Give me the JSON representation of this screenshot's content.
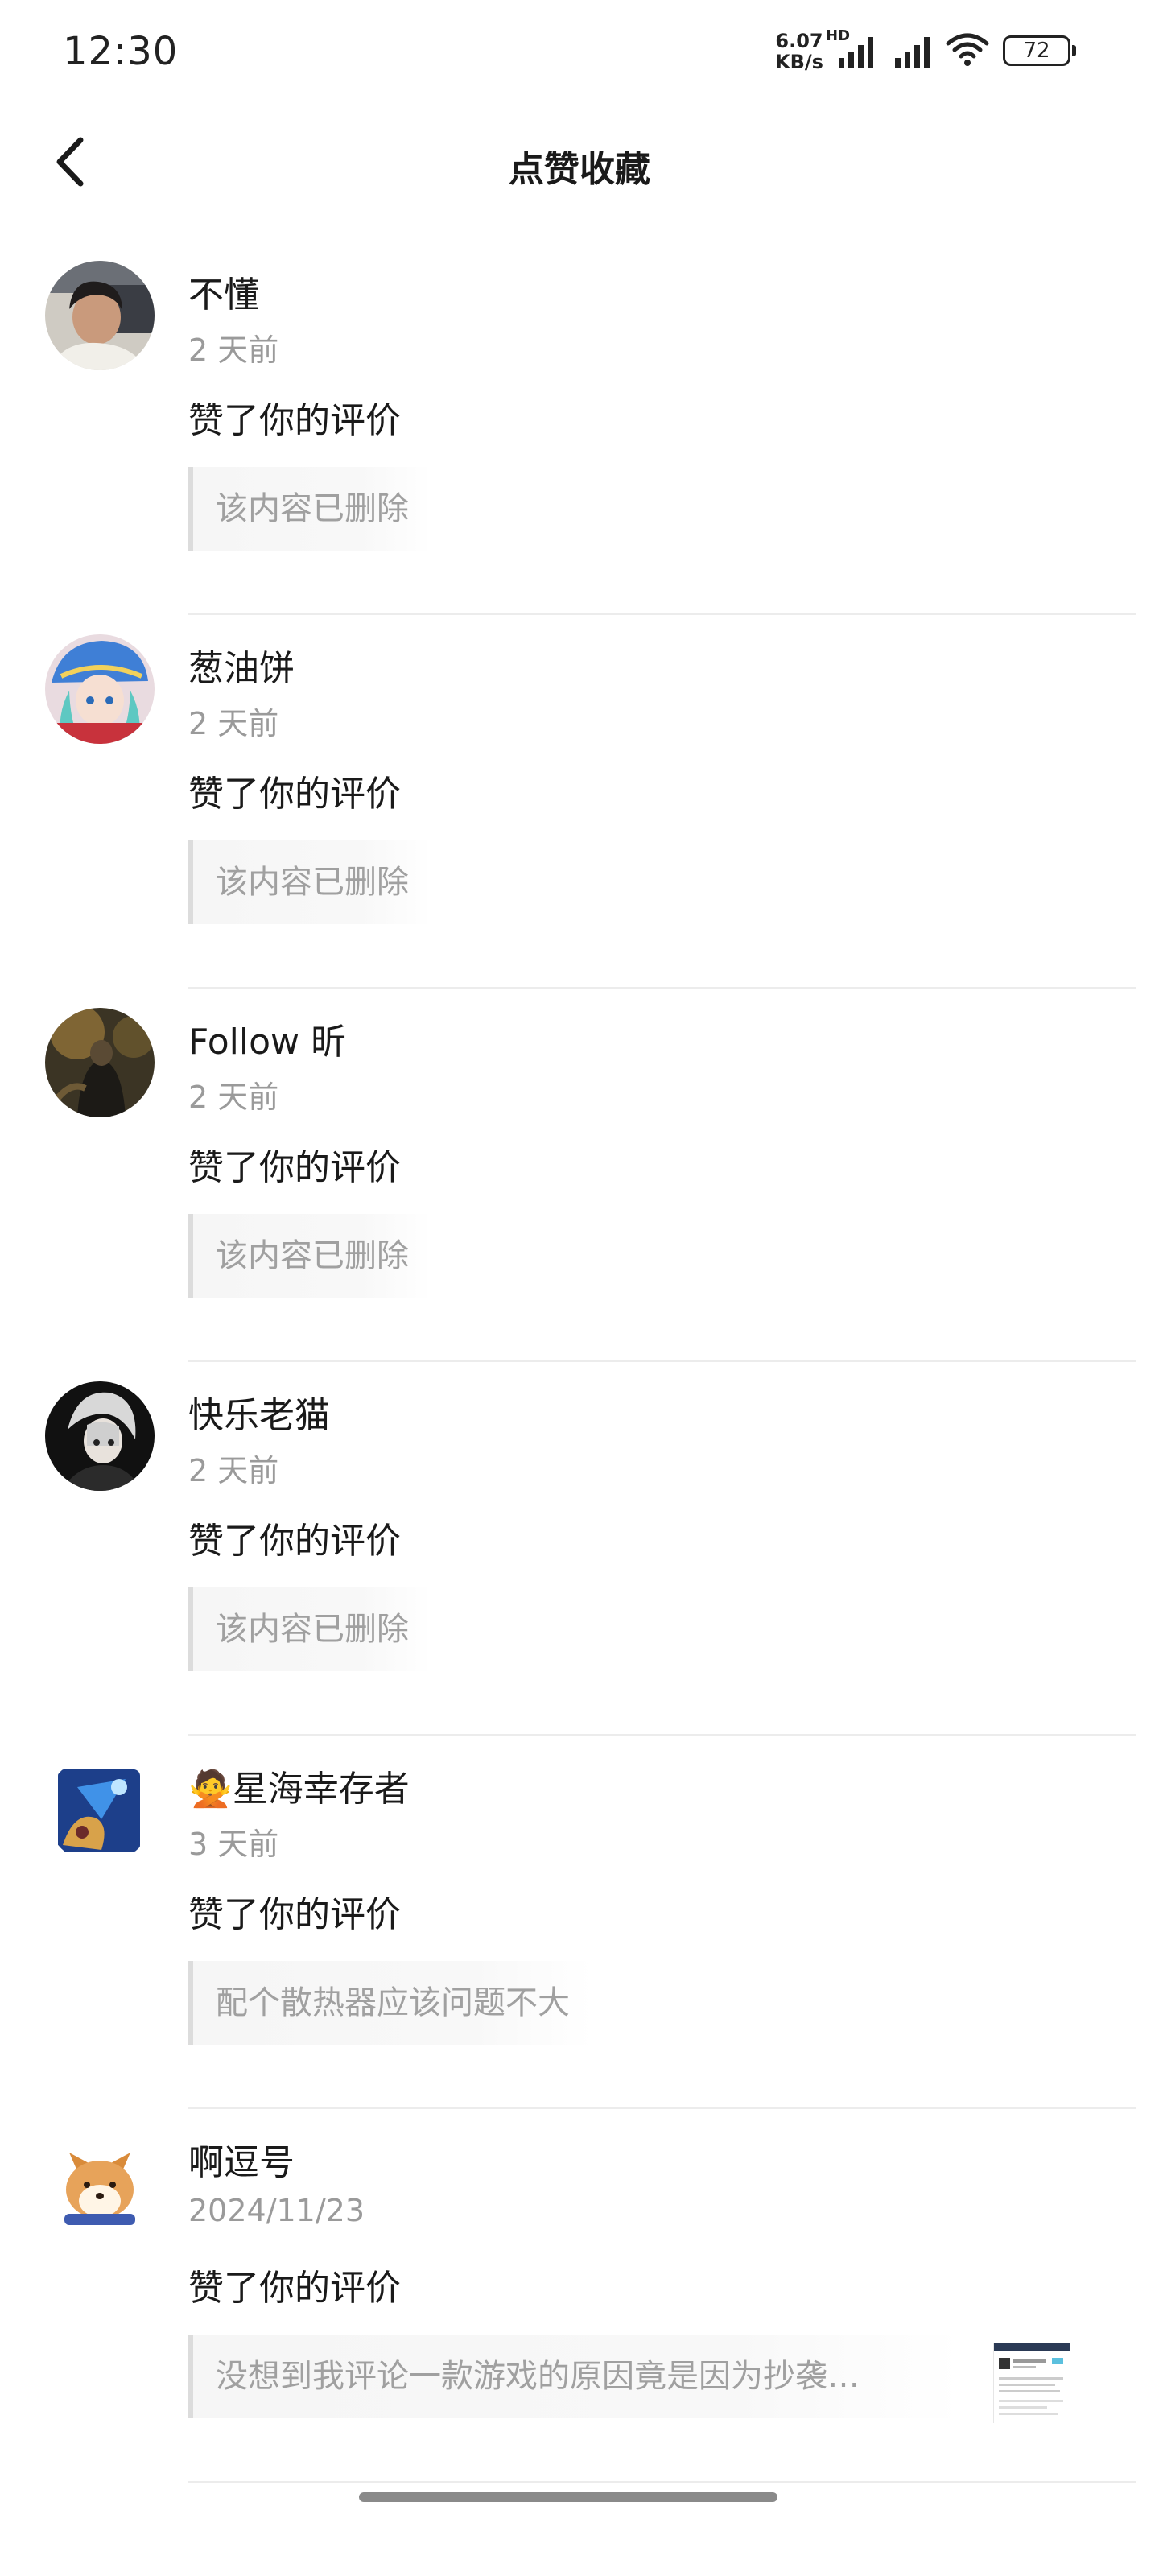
{
  "status_bar": {
    "time": "12:30",
    "net_speed_value": "6.07",
    "net_speed_unit": "KB/s",
    "hd_label": "HD",
    "battery": "72"
  },
  "header": {
    "title": "点赞收藏",
    "back_icon": "chevron-left-icon"
  },
  "items": [
    {
      "username": "不懂",
      "time": "2 天前",
      "action": "赞了你的评价",
      "quote": "该内容已删除"
    },
    {
      "username": "葱油饼",
      "time": "2 天前",
      "action": "赞了你的评价",
      "quote": "该内容已删除"
    },
    {
      "username": "Follow 昕",
      "time": "2 天前",
      "action": "赞了你的评价",
      "quote": "该内容已删除"
    },
    {
      "username": "快乐老猫",
      "time": "2 天前",
      "action": "赞了你的评价",
      "quote": "该内容已删除"
    },
    {
      "username": "🙅星海幸存者",
      "time": "3 天前",
      "action": "赞了你的评价",
      "quote": "配个散热器应该问题不大"
    },
    {
      "username": "啊逗号",
      "time": "2024/11/23",
      "action": "赞了你的评价",
      "quote": "没想到我评论一款游戏的原因竟是因为抄袭…"
    }
  ]
}
